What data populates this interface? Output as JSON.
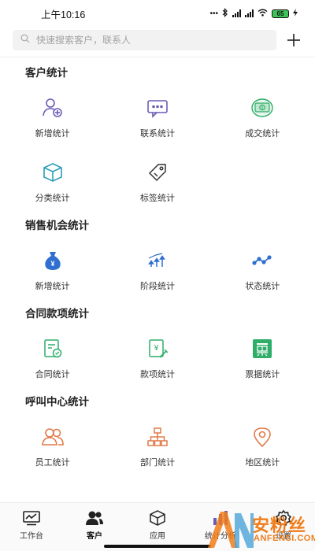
{
  "status_bar": {
    "time": "上午10:16",
    "net": "4G",
    "battery": "65"
  },
  "search": {
    "placeholder": "快速搜索客户，联系人"
  },
  "sections": [
    {
      "title": "客户统计",
      "items": [
        {
          "label": "新增统计",
          "icon": "user-add-icon"
        },
        {
          "label": "联系统计",
          "icon": "chat-icon"
        },
        {
          "label": "成交统计",
          "icon": "money-icon"
        },
        {
          "label": "分类统计",
          "icon": "box-icon"
        },
        {
          "label": "标签统计",
          "icon": "tag-icon"
        }
      ]
    },
    {
      "title": "销售机会统计",
      "items": [
        {
          "label": "新增统计",
          "icon": "money-bag-icon"
        },
        {
          "label": "阶段统计",
          "icon": "stage-arrows-icon"
        },
        {
          "label": "状态统计",
          "icon": "status-line-icon"
        }
      ]
    },
    {
      "title": "合同款项统计",
      "items": [
        {
          "label": "合同统计",
          "icon": "contract-icon"
        },
        {
          "label": "款项统计",
          "icon": "payment-icon"
        },
        {
          "label": "票据统计",
          "icon": "ticket-icon"
        }
      ]
    },
    {
      "title": "呼叫中心统计",
      "items": [
        {
          "label": "员工统计",
          "icon": "staff-icon"
        },
        {
          "label": "部门统计",
          "icon": "org-chart-icon"
        },
        {
          "label": "地区统计",
          "icon": "location-pin-icon"
        }
      ]
    }
  ],
  "nav": [
    {
      "label": "工作台",
      "icon": "workbench-icon"
    },
    {
      "label": "客户",
      "icon": "customers-icon",
      "active": true
    },
    {
      "label": "应用",
      "icon": "apps-icon"
    },
    {
      "label": "统计分析",
      "icon": "statistics-icon"
    },
    {
      "label": "设置",
      "icon": "settings-icon"
    }
  ],
  "watermark": {
    "text": "安粉丝",
    "sub": "ANFENSI.COM"
  },
  "colors": {
    "purple": "#6b5bb5",
    "green": "#2fae6a",
    "teal": "#2b9fb8",
    "blue": "#2f6fd0",
    "orange": "#e07a4a"
  }
}
